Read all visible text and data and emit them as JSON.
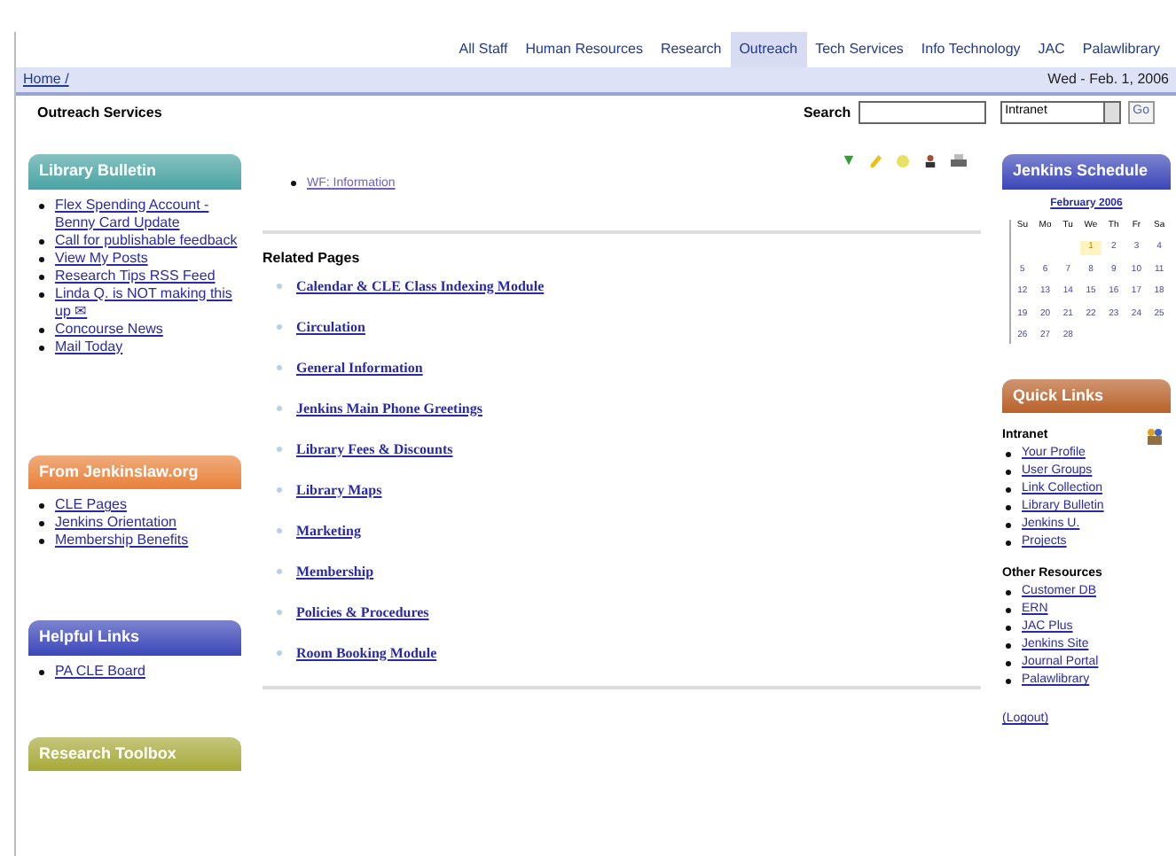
{
  "nav_tabs": [
    {
      "label": "All Staff",
      "selected": false
    },
    {
      "label": "Human Resources",
      "selected": false
    },
    {
      "label": "Research",
      "selected": false
    },
    {
      "label": "Outreach",
      "selected": true
    },
    {
      "label": "Tech Services",
      "selected": false
    },
    {
      "label": "Info Technology",
      "selected": false
    },
    {
      "label": "JAC",
      "selected": false
    },
    {
      "label": "Palawlibrary",
      "selected": false
    }
  ],
  "breadcrumb": "Home /",
  "date": "Wed - Feb. 1, 2006",
  "page_title": "Outreach Services",
  "search": {
    "label": "Search",
    "scope": "Intranet",
    "button": "Go"
  },
  "left_boxes": [
    {
      "title": "Library Bulletin",
      "color": "#4aa3a3",
      "links": [
        "Flex Spending Account - Benny Card Update",
        "Call for publishable feedback",
        "View My Posts",
        "Research Tips RSS Feed",
        "Linda Q. is NOT making this up ✉",
        "Concourse News",
        "Mail Today"
      ]
    },
    {
      "title": "From Jenkinslaw.org",
      "color": "#e8813a",
      "links": [
        "CLE Pages",
        "Jenkins Orientation",
        "Membership Benefits"
      ]
    },
    {
      "title": "Helpful Links",
      "color": "#3b47b8",
      "links": [
        "PA CLE Board"
      ]
    },
    {
      "title": "Research Toolbox",
      "color": "#a7a93a"
    }
  ],
  "main": {
    "top_links": [
      "WF: Information"
    ],
    "related_heading": "Related Pages",
    "related_pages": [
      "Calendar & CLE Class Indexing Module",
      "Circulation",
      "General Information",
      "Jenkins Main Phone Greetings",
      "Library Fees & Discounts",
      "Library Maps",
      "Marketing",
      "Membership",
      "Policies & Procedures",
      "Room Booking Module"
    ]
  },
  "schedule": {
    "title": "Jenkins Schedule",
    "month": "February 2006",
    "weekdays": [
      "Su",
      "Mo",
      "Tu",
      "We",
      "Th",
      "Fr",
      "Sa"
    ],
    "weeks": [
      [
        {
          "day": "1",
          "selected": true
        },
        {
          "day": "2",
          "selected": false
        },
        {
          "day": "3",
          "selected": false
        },
        {
          "day": "4",
          "selected": false
        }
      ],
      [
        {
          "day": "5",
          "selected": false
        },
        {
          "day": "6",
          "selected": false
        },
        {
          "day": "7",
          "selected": false
        },
        {
          "day": "8",
          "selected": false
        },
        {
          "day": "9",
          "selected": false
        },
        {
          "day": "10",
          "selected": false
        },
        {
          "day": "11",
          "selected": false
        }
      ],
      [
        {
          "day": "12",
          "selected": false
        },
        {
          "day": "13",
          "selected": false
        },
        {
          "day": "14",
          "selected": false
        },
        {
          "day": "15",
          "selected": false
        },
        {
          "day": "16",
          "selected": false
        },
        {
          "day": "17",
          "selected": false
        },
        {
          "day": "18",
          "selected": false
        }
      ],
      [
        {
          "day": "19",
          "selected": false
        },
        {
          "day": "20",
          "selected": false
        },
        {
          "day": "21",
          "selected": false
        },
        {
          "day": "22",
          "selected": false
        },
        {
          "day": "23",
          "selected": false
        },
        {
          "day": "24",
          "selected": false
        },
        {
          "day": "25",
          "selected": false
        }
      ],
      [
        {
          "day": "26",
          "selected": false
        },
        {
          "day": "27",
          "selected": false
        },
        {
          "day": "28",
          "selected": false
        }
      ]
    ]
  },
  "quick_links": {
    "title": "Quick Links",
    "groups": [
      {
        "heading": "Intranet",
        "links": [
          "Your Profile",
          "User Groups",
          "Link Collection",
          "Library Bulletin",
          "Jenkins U.",
          "Projects"
        ]
      },
      {
        "heading": "Other Resources",
        "links": [
          "Customer DB",
          "ERN",
          "JAC Plus",
          "Jenkins Site",
          "Journal Portal",
          "Palawlibrary"
        ]
      }
    ],
    "logout": "(Logout)"
  }
}
